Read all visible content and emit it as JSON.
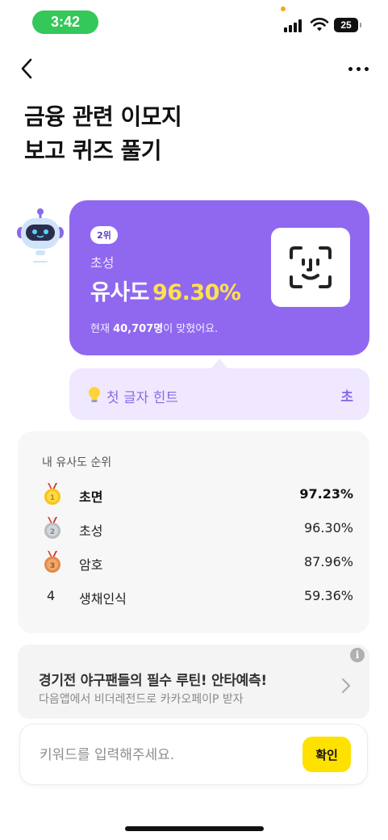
{
  "status_bar": {
    "time": "3:42",
    "battery": "25"
  },
  "header": {
    "title_line1": "금융 관련 이모지",
    "title_line2": "보고 퀴즈 풀기"
  },
  "answer_card": {
    "rank_badge": "2위",
    "word": "초성",
    "similarity_label": "유사도",
    "similarity_value": "96.30%",
    "solved_prefix": "현재 ",
    "solved_count": "40,707명",
    "solved_suffix": "이 맞혔어요.",
    "emoji_icon": "face-scan-icon"
  },
  "hint": {
    "label": "첫 글자 힌트",
    "value": "초"
  },
  "ranking": {
    "title": "내 유사도 순위",
    "rows": [
      {
        "rank": "1",
        "medal": "gold",
        "word": "초면",
        "value": "97.23%"
      },
      {
        "rank": "2",
        "medal": "silver",
        "word": "초성",
        "value": "96.30%"
      },
      {
        "rank": "3",
        "medal": "bronze",
        "word": "암호",
        "value": "87.96%"
      },
      {
        "rank": "4",
        "medal": "",
        "word": "생채인식",
        "value": "59.36%"
      }
    ]
  },
  "ad": {
    "title": "경기전 야구팬들의 필수 루틴! 안타예측!",
    "subtitle": "다음앱에서 비더레전드로 카카오페이P 받자",
    "info": "i"
  },
  "input": {
    "placeholder": "키워드를 입력해주세요.",
    "value": "",
    "button": "확인"
  },
  "colors": {
    "card_purple": "#9068f0",
    "hint_bg": "#efe8ff",
    "accent_yellow": "#ffe14d",
    "button_yellow": "#ffe100",
    "time_green": "#34c759"
  }
}
